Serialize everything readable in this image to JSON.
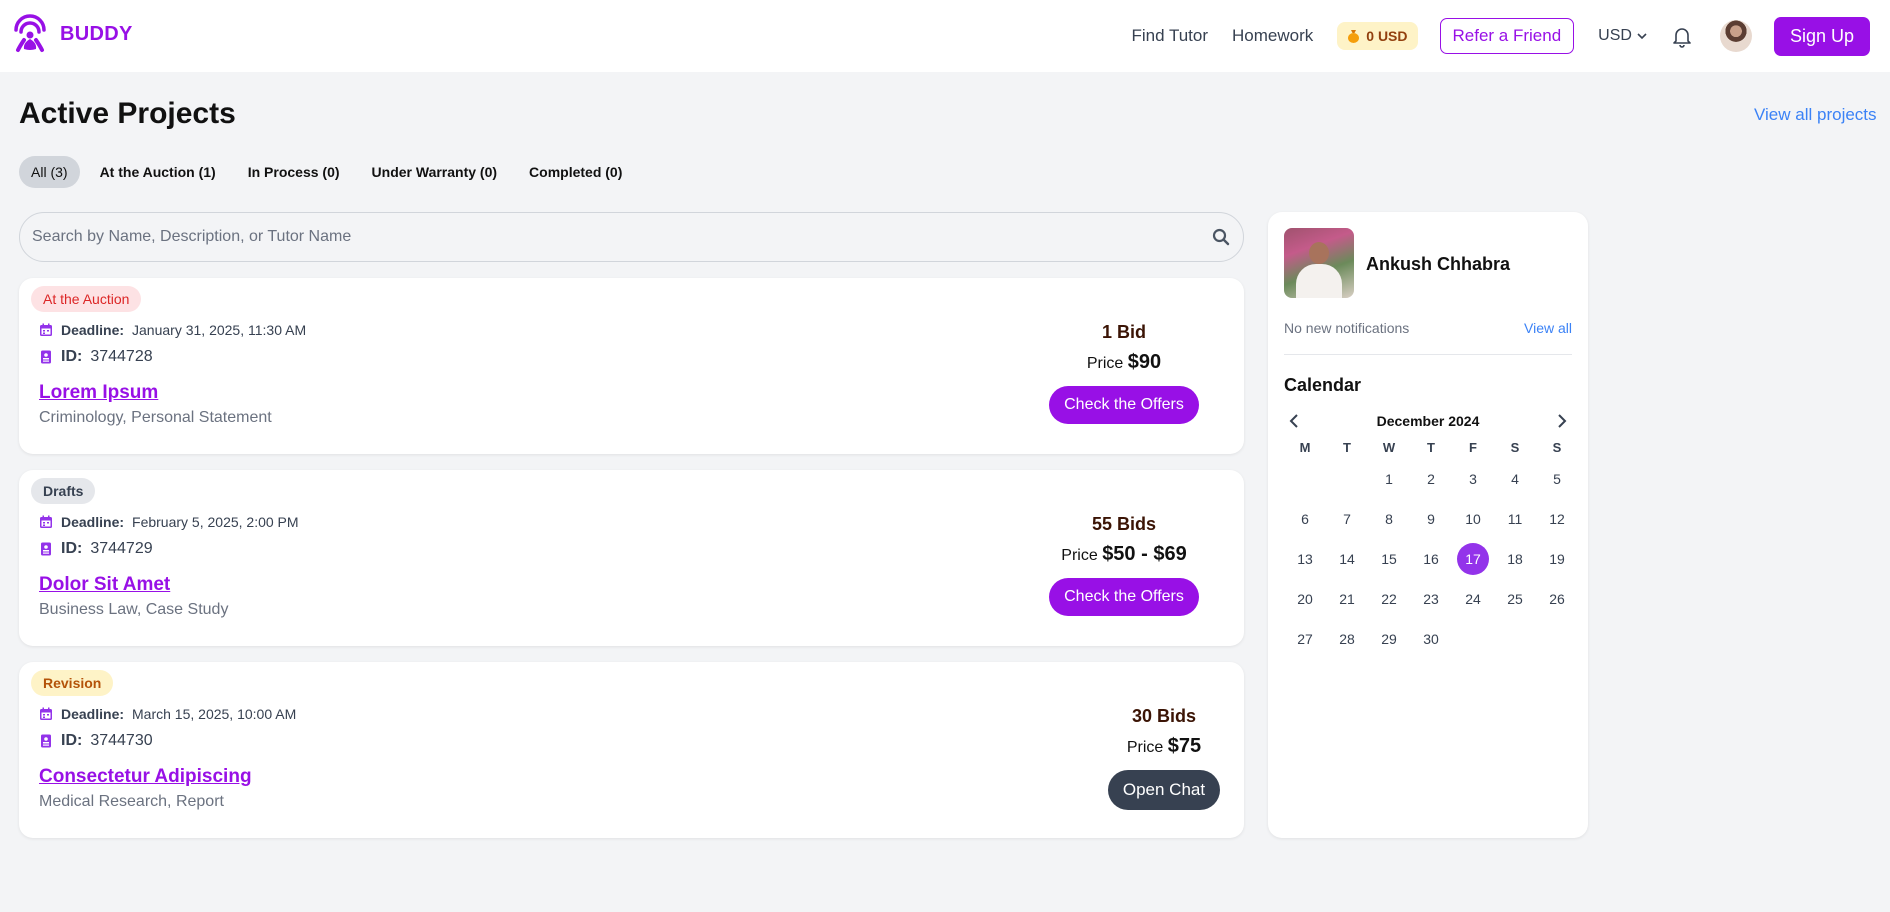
{
  "header": {
    "brand": "BUDDY",
    "nav": {
      "find_tutor": "Find Tutor",
      "homework": "Homework"
    },
    "wallet": "0 USD",
    "refer": "Refer a Friend",
    "currency": "USD",
    "signup": "Sign Up"
  },
  "page": {
    "title": "Active Projects",
    "view_all": "View all projects"
  },
  "tabs": [
    "All (3)",
    "At the Auction (1)",
    "In Process (0)",
    "Under Warranty (0)",
    "Completed (0)"
  ],
  "search": {
    "placeholder": "Search by Name, Description, or Tutor Name"
  },
  "projects": [
    {
      "status": "At the Auction",
      "deadline_label": "Deadline:",
      "deadline": "January 31, 2025, 11:30 AM",
      "id_label": "ID:",
      "id": "3744728",
      "title": "Lorem Ipsum",
      "subtitle": "Criminology, Personal Statement",
      "bids": "1 Bid",
      "price_label": "Price",
      "price": "$90",
      "action": "Check the Offers"
    },
    {
      "status": "Drafts",
      "deadline_label": "Deadline:",
      "deadline": "February 5, 2025, 2:00 PM",
      "id_label": "ID:",
      "id": "3744729",
      "title": "Dolor Sit Amet",
      "subtitle": "Business Law, Case Study",
      "bids": "55 Bids",
      "price_label": "Price",
      "price": "$50 - $69",
      "action": "Check the Offers"
    },
    {
      "status": "Revision",
      "deadline_label": "Deadline:",
      "deadline": "March 15, 2025, 10:00 AM",
      "id_label": "ID:",
      "id": "3744730",
      "title": "Consectetur Adipiscing",
      "subtitle": "Medical Research, Report",
      "bids": "30 Bids",
      "price_label": "Price",
      "price": "$75",
      "action": "Open Chat"
    }
  ],
  "sidebar": {
    "name": "Ankush Chhabra",
    "notifications": "No new notifications",
    "view_all": "View all",
    "calendar_title": "Calendar",
    "month": "December 2024",
    "weekdays": [
      "M",
      "T",
      "W",
      "T",
      "F",
      "S",
      "S"
    ],
    "leading_blanks": 2,
    "days_in_month": 30,
    "selected_day": 17
  },
  "colors": {
    "brand": "#9810e6",
    "link": "#3b82f6",
    "dark_button": "#374151"
  }
}
